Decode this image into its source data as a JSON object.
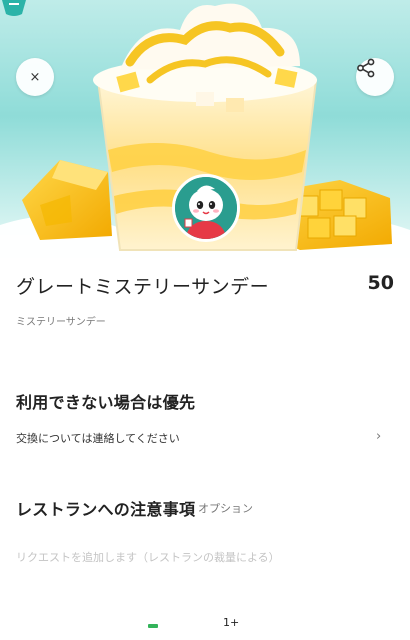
{
  "header": {
    "close_icon": "close-icon",
    "close_glyph": "×",
    "share_icon": "share-icon"
  },
  "product": {
    "name": "グレートミステリーサンデー",
    "price": "50",
    "subtitle": "ミステリーサンデー"
  },
  "preference": {
    "title": "利用できない場合は優先",
    "option_text": "交換については連絡してください",
    "chevron": "›"
  },
  "notes": {
    "title": "レストランへの注意事項",
    "optional_label": "オプション",
    "placeholder": "リクエストを追加します（レストランの裁量による）"
  },
  "quantity": {
    "value": "1+"
  },
  "colors": {
    "accent": "#33b35a",
    "hero_bg": "#8fdcd8",
    "mango": "#f7c21a",
    "avatar_bg": "#2a9d8f"
  }
}
